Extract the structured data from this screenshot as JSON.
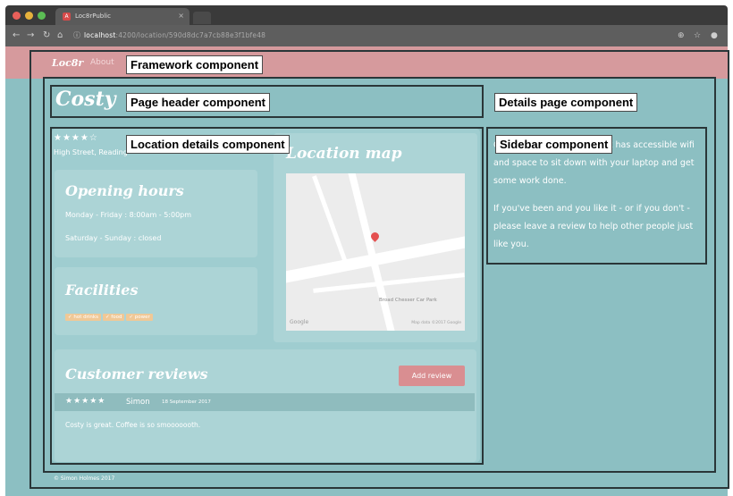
{
  "browser": {
    "tab_title": "Loc8rPublic",
    "tab_favicon_text": "A",
    "tab_close": "×",
    "url_host": "localhost",
    "url_rest": ":4200/location/590d8dc7a7cb88e3f1bfe48",
    "icons": [
      "back-arrow-icon",
      "forward-arrow-icon",
      "reload-icon",
      "home-icon",
      "info-icon",
      "extension-icon",
      "star-icon",
      "account-icon"
    ],
    "colors": {
      "close": "#e9605a",
      "minimize": "#e6b13c",
      "maximize": "#5bbd54"
    }
  },
  "app": {
    "brand": "Loc8r",
    "nav_about": "About",
    "colors": {
      "navbar": "#d69a9d",
      "page_bg": "#8cbfc2",
      "accent": "#d98e91"
    }
  },
  "header": {
    "title": "Costy"
  },
  "location": {
    "rating_stars": "★★★★☆",
    "address": "High Street, Reading",
    "opening_hours": {
      "title": "Opening hours",
      "lines": [
        "Monday - Friday : 8:00am - 5:00pm",
        "Saturday - Sunday : closed"
      ]
    },
    "facilities": {
      "title": "Facilities",
      "items": [
        "✓ hot drinks",
        "✓ food",
        "✓ power"
      ]
    },
    "map": {
      "title": "Location map",
      "google": "Google",
      "poi": "Broad Chesser Car Park",
      "copyright": "Map data ©2017 Google"
    }
  },
  "reviews": {
    "title": "Customer reviews",
    "add_button": "Add review",
    "items": [
      {
        "stars": "★★★★★",
        "author": "Simon",
        "date": "18 September 2017",
        "text": "Costy is great. Coffee is so smooooooth."
      }
    ]
  },
  "sidebar": {
    "paragraphs": [
      "Costy is on Loc8r because it has accessible wifi and space to sit down with your laptop and get some work done.",
      "If you've been and you like it - or if you don't - please leave a review to help other people just like you."
    ]
  },
  "footer": {
    "text": "© Simon Holmes 2017"
  },
  "annotations": {
    "framework": "Framework component",
    "details_page": "Details page component",
    "page_header": "Page header component",
    "location_details": "Location details component",
    "sidebar": "Sidebar component"
  }
}
